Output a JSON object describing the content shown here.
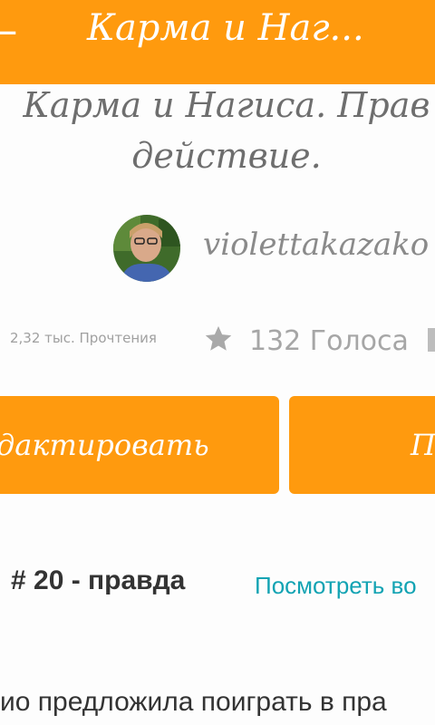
{
  "appbar": {
    "back_icon": "arrow-left-icon",
    "title": "Карма и Наг..."
  },
  "story": {
    "title_line1": "Карма и Нагиса. Прав",
    "title_line2": "действие.",
    "author": "violettakazako"
  },
  "stats": {
    "reads": "2,32 тыс. Прочтения",
    "star_icon": "star-icon",
    "votes": "132 Голоса"
  },
  "actions": {
    "edit_label": "дактировать",
    "second_label": "Пр"
  },
  "chapter": {
    "label": "# 20 - правда",
    "see_all": "Посмотреть во"
  },
  "excerpt": "ио предложила поиграть в пра",
  "colors": {
    "accent": "#ff9a0e",
    "link": "#12a3b3"
  }
}
